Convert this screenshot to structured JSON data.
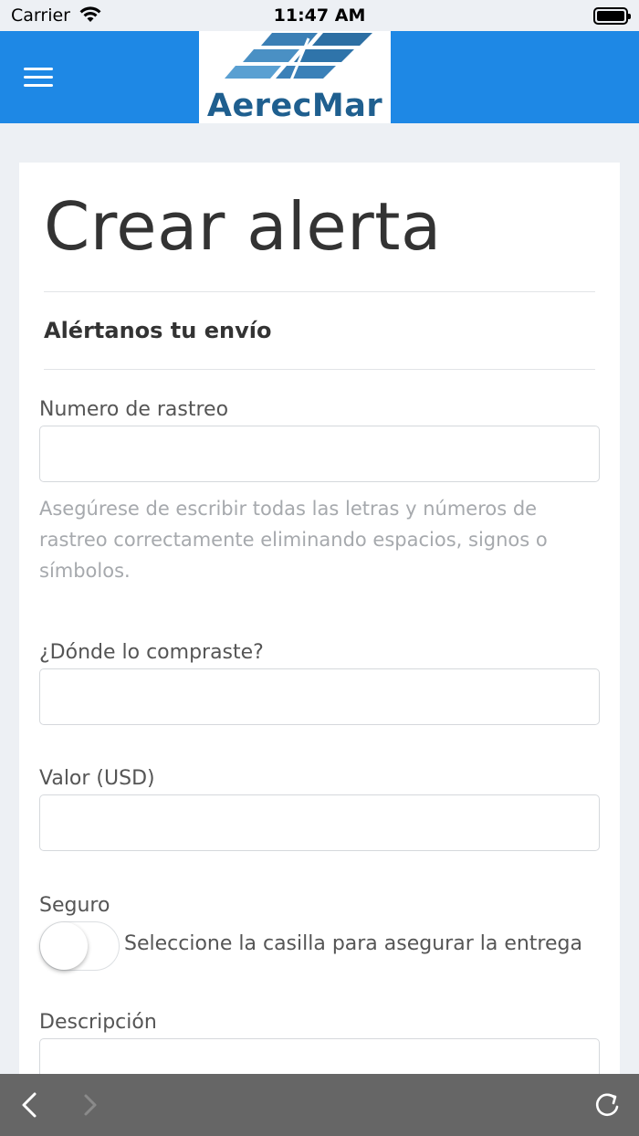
{
  "status_bar": {
    "carrier": "Carrier",
    "time": "11:47 AM"
  },
  "header": {
    "menu_icon": "hamburger-menu-icon",
    "logo_text": "AerecMar",
    "background_color": "#1e88e5"
  },
  "card": {
    "title": "Crear alerta",
    "subtitle": "Alértanos tu envío"
  },
  "form": {
    "tracking_label": "Numero de rastreo",
    "tracking_value": "",
    "tracking_help": "Asegúrese de escribir todas las letras y números de rastreo correctamente eliminando espacios, signos o símbolos.",
    "store_label": "¿Dónde lo compraste?",
    "store_value": "",
    "value_label": "Valor (USD)",
    "value_value": "",
    "insurance_label": "Seguro",
    "insurance_text": "Seleccione la casilla para asegurar la entrega",
    "insurance_on": false,
    "description_label": "Descripción",
    "description_value": ""
  },
  "toolbar": {
    "back_icon": "chevron-left-icon",
    "forward_icon": "chevron-right-icon",
    "reload_icon": "reload-icon",
    "background_color": "#666666"
  }
}
